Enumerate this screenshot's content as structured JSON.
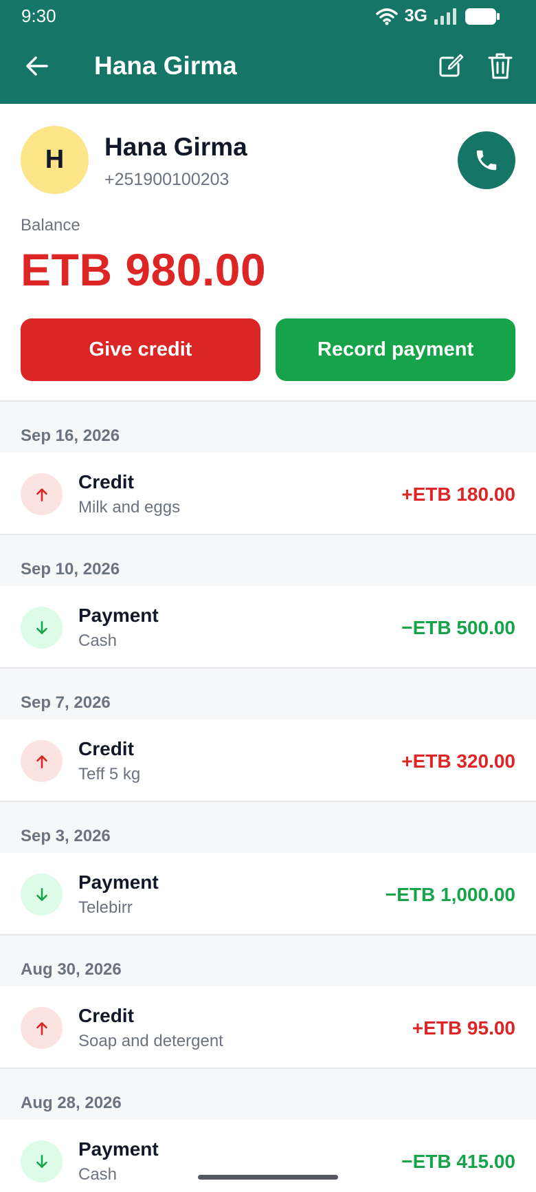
{
  "status": {
    "time": "9:30",
    "network": "3G"
  },
  "appbar": {
    "title": "Hana Girma"
  },
  "customer": {
    "initial": "H",
    "name": "Hana Girma",
    "phone": "+251900100203"
  },
  "balance": {
    "label": "Balance",
    "value": "ETB 980.00"
  },
  "actions": {
    "give_credit": "Give credit",
    "record_payment": "Record payment"
  },
  "colors": {
    "primary": "#157567",
    "credit": "#dc2626",
    "payment": "#16a34a",
    "avatar": "#fce588"
  },
  "transactions": [
    {
      "date": "Sep 16, 2026",
      "type": "Credit",
      "note": "Milk and eggs",
      "amount": "+ETB 180.00",
      "direction": "up"
    },
    {
      "date": "Sep 10, 2026",
      "type": "Payment",
      "note": "Cash",
      "amount": "−ETB 500.00",
      "direction": "down"
    },
    {
      "date": "Sep 7, 2026",
      "type": "Credit",
      "note": "Teff 5 kg",
      "amount": "+ETB 320.00",
      "direction": "up"
    },
    {
      "date": "Sep 3, 2026",
      "type": "Payment",
      "note": "Telebirr",
      "amount": "−ETB 1,000.00",
      "direction": "down"
    },
    {
      "date": "Aug 30, 2026",
      "type": "Credit",
      "note": "Soap and detergent",
      "amount": "+ETB 95.00",
      "direction": "up"
    },
    {
      "date": "Aug 28, 2026",
      "type": "Payment",
      "note": "Cash",
      "amount": "−ETB 415.00",
      "direction": "down"
    }
  ]
}
